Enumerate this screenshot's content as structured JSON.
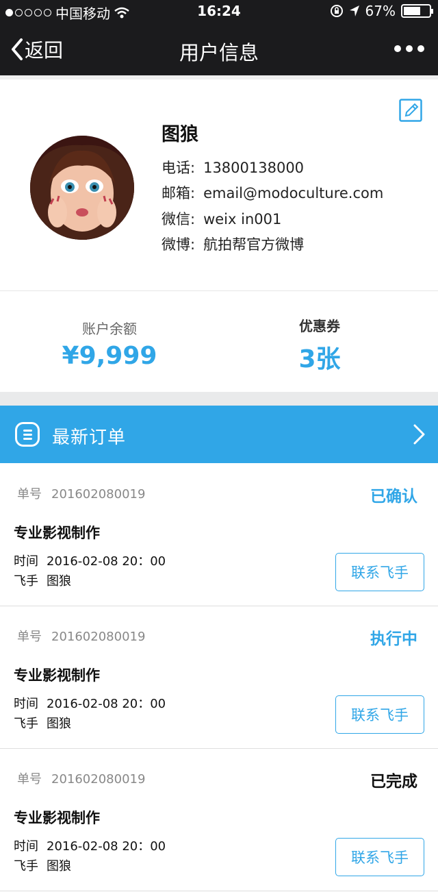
{
  "status_bar": {
    "carrier": "中国移动",
    "time": "16:24",
    "battery": "67%",
    "battery_level": 0.67
  },
  "nav": {
    "back_label": "返回",
    "title": "用户信息"
  },
  "profile": {
    "name": "图狼",
    "phone_label": "电话:",
    "phone": "13800138000",
    "email_label": "邮箱:",
    "email": "email@modoculture.com",
    "wechat_label": "微信:",
    "wechat": "weix in001",
    "weibo_label": "微博:",
    "weibo": "航拍帮官方微博"
  },
  "stats": {
    "balance_label": "账户余额",
    "balance": "¥9,999",
    "coupon_label": "优惠券",
    "coupon": "3张"
  },
  "orders_header": {
    "title": "最新订单"
  },
  "orders": [
    {
      "no_label": "单号",
      "no": "201602080019",
      "status": "已确认",
      "service": "专业影视制作",
      "time_label": "时间",
      "time": "2016-02-08  20：00",
      "pilot_label": "飞手",
      "pilot": "图狼",
      "button": "联系飞手"
    },
    {
      "no_label": "单号",
      "no": "201602080019",
      "status": "执行中",
      "service": "专业影视制作",
      "time_label": "时间",
      "time": "2016-02-08  20：00",
      "pilot_label": "飞手",
      "pilot": "图狼",
      "button": "联系飞手"
    },
    {
      "no_label": "单号",
      "no": "201602080019",
      "status": "已完成",
      "service": "专业影视制作",
      "time_label": "时间",
      "time": "2016-02-08  20：00",
      "pilot_label": "飞手",
      "pilot": "图狼",
      "button": "联系飞手"
    }
  ],
  "colors": {
    "accent": "#30a6e7",
    "nav_bg": "#1b1b1d",
    "status_done": "#111111"
  },
  "icons": [
    "wifi-icon",
    "lock-rotation-icon",
    "location-icon",
    "battery-icon",
    "back-chevron-icon",
    "more-icon",
    "edit-icon",
    "list-icon",
    "chevron-right-icon"
  ]
}
